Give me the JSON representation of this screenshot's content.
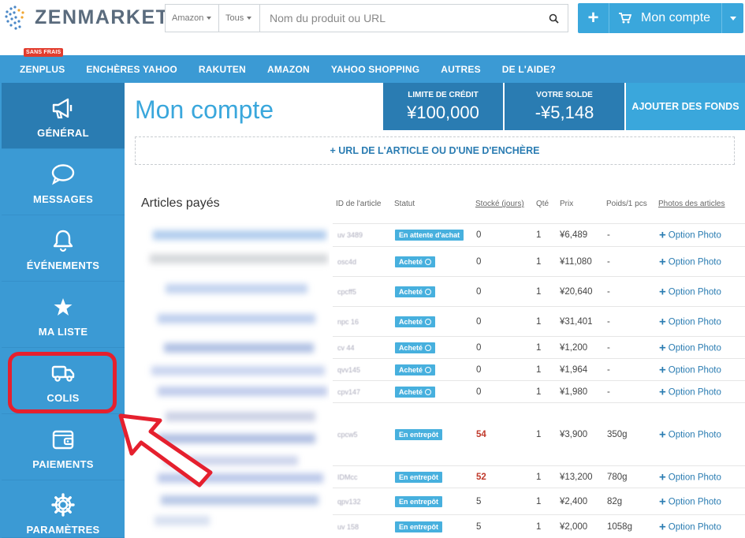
{
  "header": {
    "logo_text": "ZENMARKET",
    "search": {
      "source_select": "Amazon",
      "category_select": "Tous",
      "placeholder": "Nom du produit ou URL"
    },
    "account_button": "Mon compte"
  },
  "nav": {
    "items": [
      "ZENPLUS",
      "ENCHÈRES YAHOO",
      "RAKUTEN",
      "AMAZON",
      "YAHOO SHOPPING",
      "AUTRES",
      "DE L'AIDE?"
    ],
    "badge": "SANS FRAIS"
  },
  "sidebar": {
    "items": [
      {
        "label": "GÉNÉRAL",
        "icon": "megaphone-icon",
        "active": true
      },
      {
        "label": "MESSAGES",
        "icon": "chat-bubble-icon"
      },
      {
        "label": "ÉVÉNEMENTS",
        "icon": "bell-icon"
      },
      {
        "label": "MA LISTE",
        "icon": "star-icon"
      },
      {
        "label": "COLIS",
        "icon": "truck-icon"
      },
      {
        "label": "PAIEMENTS",
        "icon": "wallet-icon"
      },
      {
        "label": "PARAMÈTRES",
        "icon": "gear-icon"
      }
    ]
  },
  "main": {
    "title": "Mon compte",
    "credit_limit": {
      "label": "LIMITE DE CRÉDIT",
      "value": "¥100,000"
    },
    "balance": {
      "label": "VOTRE SOLDE",
      "value": "-¥5,148"
    },
    "add_funds": "AJOUTER DES FONDS",
    "url_box": "+ URL DE L'ARTICLE OU D'UNE D'ENCHÈRE",
    "section_title": "Articles payés",
    "table": {
      "headers": [
        "ID de l'article",
        "Statut",
        "Stocké (jours)",
        "Qté",
        "Prix",
        "Poids/1 pcs",
        "Photos des articles"
      ],
      "photo_label": "Option Photo",
      "rows": [
        {
          "id": "uv 3489",
          "status": "En attente d'achat",
          "clock": false,
          "stock": "0",
          "red": false,
          "qty": "1",
          "price": "¥6,489",
          "weight": "-"
        },
        {
          "id": "osc4d",
          "status": "Acheté",
          "clock": true,
          "stock": "0",
          "red": false,
          "qty": "1",
          "price": "¥11,080",
          "weight": "-"
        },
        {
          "id": "cpcff5",
          "status": "Acheté",
          "clock": true,
          "stock": "0",
          "red": false,
          "qty": "1",
          "price": "¥20,640",
          "weight": "-"
        },
        {
          "id": "npc 16",
          "status": "Acheté",
          "clock": true,
          "stock": "0",
          "red": false,
          "qty": "1",
          "price": "¥31,401",
          "weight": "-"
        },
        {
          "id": "cv 44",
          "status": "Acheté",
          "clock": true,
          "stock": "0",
          "red": false,
          "qty": "1",
          "price": "¥1,200",
          "weight": "-"
        },
        {
          "id": "qvv145",
          "status": "Acheté",
          "clock": true,
          "stock": "0",
          "red": false,
          "qty": "1",
          "price": "¥1,964",
          "weight": "-"
        },
        {
          "id": "cpv147",
          "status": "Acheté",
          "clock": true,
          "stock": "0",
          "red": false,
          "qty": "1",
          "price": "¥1,980",
          "weight": "-"
        },
        {
          "id": "cpcw5",
          "status": "En entrepôt",
          "clock": false,
          "stock": "54",
          "red": true,
          "qty": "1",
          "price": "¥3,900",
          "weight": "350g"
        },
        {
          "id": "IDMcc",
          "status": "En entrepôt",
          "clock": false,
          "stock": "52",
          "red": true,
          "qty": "1",
          "price": "¥13,200",
          "weight": "780g"
        },
        {
          "id": "qpv132",
          "status": "En entrepôt",
          "clock": false,
          "stock": "5",
          "red": false,
          "qty": "1",
          "price": "¥2,400",
          "weight": "82g"
        },
        {
          "id": "uv 158",
          "status": "En entrepôt",
          "clock": false,
          "stock": "5",
          "red": false,
          "qty": "1",
          "price": "¥2,000",
          "weight": "1058g"
        }
      ]
    }
  },
  "colors": {
    "primary": "#3b9ad4",
    "dark": "#2a7cb2",
    "annotation": "#e5202e"
  }
}
